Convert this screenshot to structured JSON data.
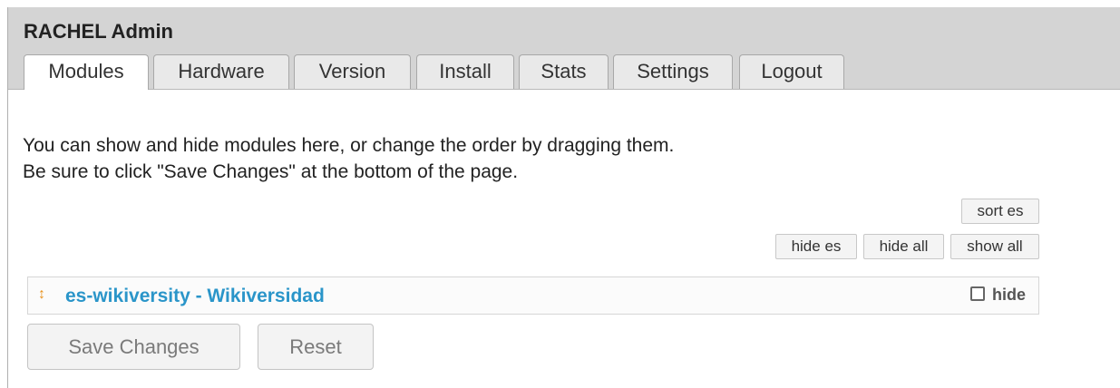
{
  "header": {
    "title": "RACHEL Admin",
    "tabs": [
      {
        "label": "Modules",
        "active": true
      },
      {
        "label": "Hardware",
        "active": false
      },
      {
        "label": "Version",
        "active": false
      },
      {
        "label": "Install",
        "active": false
      },
      {
        "label": "Stats",
        "active": false
      },
      {
        "label": "Settings",
        "active": false
      },
      {
        "label": "Logout",
        "active": false
      }
    ]
  },
  "main": {
    "instructions": {
      "line1": "You can show and hide modules here, or change the order by dragging them.",
      "line2": "Be sure to click \"Save Changes\" at the bottom of the page."
    },
    "controls": {
      "sort_es": "sort es",
      "hide_es": "hide es",
      "hide_all": "hide all",
      "show_all": "show all"
    },
    "modules": [
      {
        "drag_icon": "↕",
        "title": "es-wikiversity - Wikiversidad",
        "hide_label": "hide",
        "hidden": false
      }
    ],
    "actions": {
      "save": "Save Changes",
      "reset": "Reset"
    }
  },
  "colors": {
    "header_bg": "#d4d4d4",
    "link": "#2a95c9",
    "drag_handle": "#e8901a"
  },
  "icons": {
    "drag_handle": "drag-handle-icon",
    "checkbox": "checkbox-icon"
  }
}
